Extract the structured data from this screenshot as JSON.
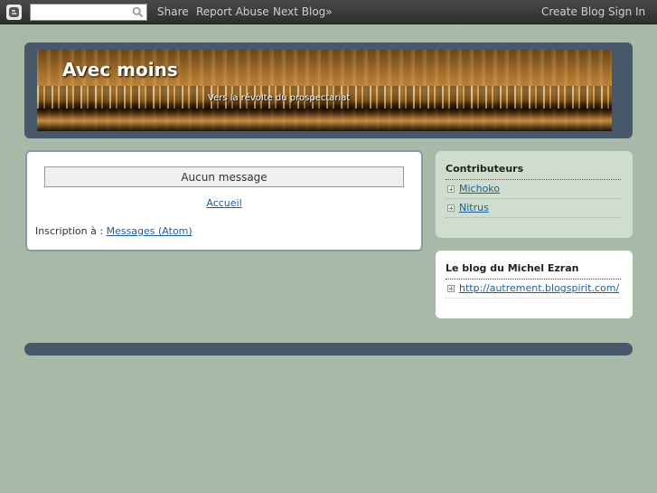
{
  "navbar": {
    "search_placeholder": "",
    "share": "Share",
    "report_abuse": "Report Abuse",
    "next_blog": "Next Blog»",
    "create_blog": "Create Blog",
    "sign_in": "Sign In"
  },
  "header": {
    "title": "Avec moins",
    "description": "Vers la révolte du prospectariat"
  },
  "main": {
    "no_messages": "Aucun message",
    "home_link": "Accueil",
    "subscribe_label": "Inscription à : ",
    "subscribe_link": "Messages (Atom)"
  },
  "sidebar": {
    "contributors": {
      "title": "Contributeurs",
      "items": [
        "Michoko",
        "Nitrus"
      ]
    },
    "blog": {
      "title": "Le blog du Michel Ezran",
      "items": [
        "http://autrement.blogspirit.com/"
      ]
    }
  },
  "colors": {
    "background": "#a9b9a7",
    "header_frame": "#46586a",
    "link": "#1f5c9c",
    "contributors_widget": "#cfddcd"
  },
  "icons": {
    "navbar_logo": "blogger-logo-icon",
    "search": "search-icon",
    "list_bullet": "plus-square-icon"
  }
}
